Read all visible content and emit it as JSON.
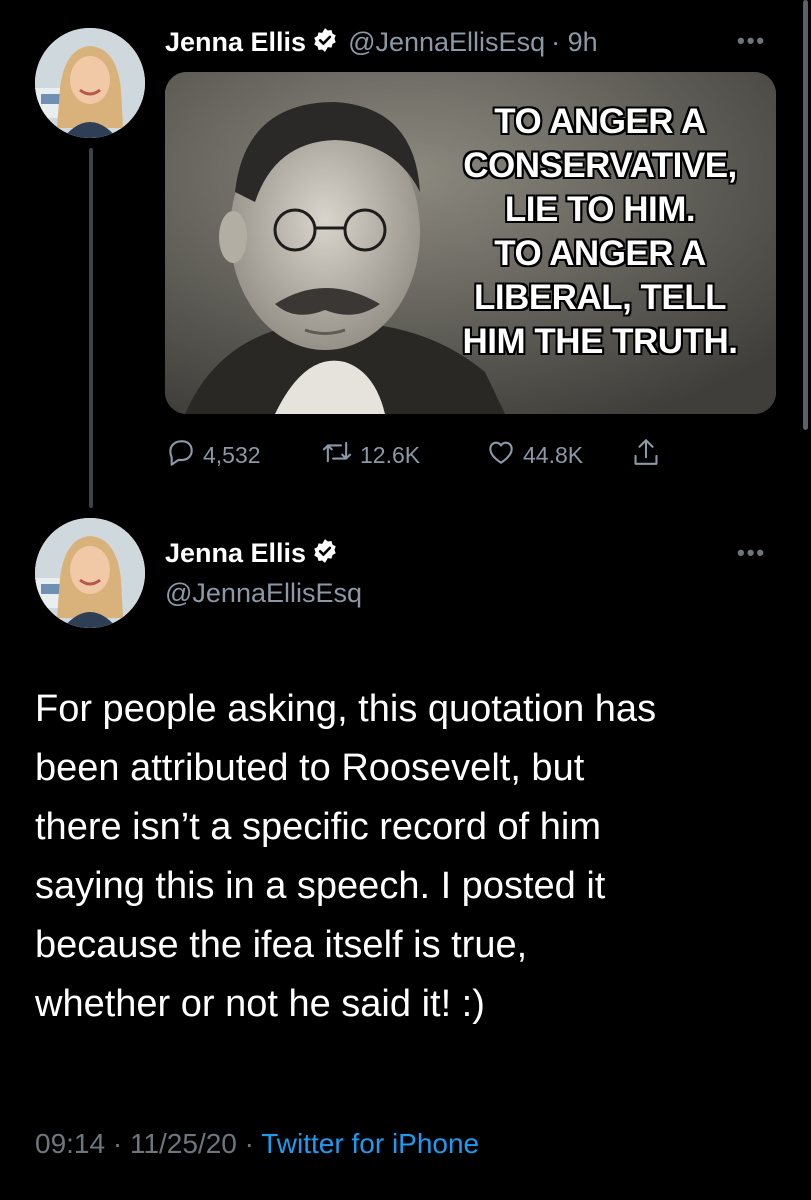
{
  "tweet1": {
    "display_name": "Jenna Ellis",
    "handle": "@JennaEllisEsq",
    "time": "· 9h",
    "more": "•••",
    "image_quote": [
      "TO ANGER A",
      "CONSERVATIVE,",
      "LIE TO HIM.",
      "TO ANGER A",
      "LIBERAL, TELL",
      "HIM THE TRUTH."
    ],
    "actions": {
      "replies": "4,532",
      "retweets": "12.6K",
      "likes": "44.8K"
    }
  },
  "tweet2": {
    "display_name": "Jenna Ellis",
    "handle": "@JennaEllisEsq",
    "more": "•••",
    "text_lines": [
      "For people asking, this quotation has",
      "been attributed to Roosevelt, but",
      "there isn’t a specific record of him",
      "saying this in a speech. I posted it",
      "because the ifea itself is true,",
      "whether or not he said it! :)"
    ],
    "time": "09:14 · 11/25/20 · ",
    "source": "Twitter for iPhone"
  },
  "colors": {
    "background": "#000000",
    "link": "#1d9bf0",
    "secondary_text": "#8b98a5",
    "verified": "#ffffff"
  }
}
